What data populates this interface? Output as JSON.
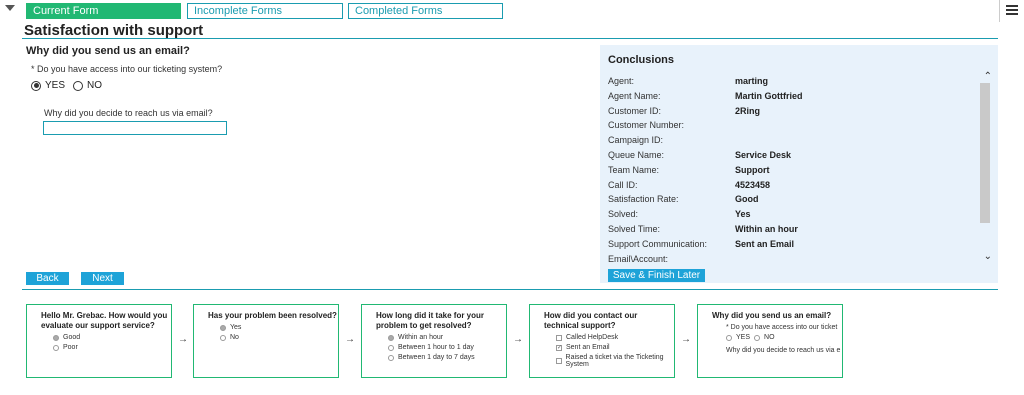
{
  "tabs": [
    {
      "label": "Current Form",
      "active": true
    },
    {
      "label": "Incomplete Forms",
      "active": false
    },
    {
      "label": "Completed Forms",
      "active": false
    }
  ],
  "page_title": "Satisfaction with support",
  "question_heading": "Why did you send us an email?",
  "q1": {
    "text": "* Do you have access into our ticketing system?",
    "options": [
      {
        "label": "YES",
        "selected": true
      },
      {
        "label": "NO",
        "selected": false
      }
    ]
  },
  "q2": {
    "text": "Why did you decide to reach us via email?",
    "value": ""
  },
  "buttons": {
    "back": "Back",
    "next": "Next",
    "save": "Save & Finish Later"
  },
  "conclusions": {
    "title": "Conclusions",
    "rows": [
      {
        "label": "Agent:",
        "value": "marting"
      },
      {
        "label": "Agent Name:",
        "value": "Martin Gottfried"
      },
      {
        "label": "Customer ID:",
        "value": "2Ring"
      },
      {
        "label": "Customer Number:",
        "value": ""
      },
      {
        "label": "Campaign ID:",
        "value": ""
      },
      {
        "label": "Queue Name:",
        "value": "Service Desk"
      },
      {
        "label": "Team Name:",
        "value": "Support"
      },
      {
        "label": "Call ID:",
        "value": "4523458"
      },
      {
        "label": "Satisfaction Rate:",
        "value": "Good"
      },
      {
        "label": "Solved:",
        "value": "Yes"
      },
      {
        "label": "Solved Time:",
        "value": "Within an hour"
      },
      {
        "label": "Support Communication:",
        "value": "Sent an Email"
      },
      {
        "label": "Email\\Account:",
        "value": ""
      }
    ]
  },
  "flow": [
    {
      "title": "Hello Mr. Grebac. How would you evaluate our support service?",
      "type": "radio",
      "options": [
        {
          "label": "Good",
          "on": true
        },
        {
          "label": "Poor",
          "on": false
        }
      ]
    },
    {
      "title": "Has your problem been resolved?",
      "type": "radio",
      "options": [
        {
          "label": "Yes",
          "on": true
        },
        {
          "label": "No",
          "on": false
        }
      ]
    },
    {
      "title": "How long did it take for your problem to get resolved?",
      "type": "radio",
      "options": [
        {
          "label": "Within an hour",
          "on": true
        },
        {
          "label": "Between 1 hour to 1 day",
          "on": false
        },
        {
          "label": "Between 1 day to 7 days",
          "on": false
        }
      ]
    },
    {
      "title": "How did you contact our technical support?",
      "type": "check",
      "options": [
        {
          "label": "Called HelpDesk",
          "on": false
        },
        {
          "label": "Sent an Email",
          "on": true
        },
        {
          "label": "Raised a ticket via the Ticketing System",
          "on": false
        }
      ]
    },
    {
      "title": "Why did you send us an email?",
      "type": "mixed",
      "line1": "* Do you have access into our ticket",
      "opt_yes": "YES",
      "opt_no": "NO",
      "line2": "Why did you decide to reach us via e"
    }
  ],
  "icons": {
    "tab_toggle": "caret-down-icon",
    "menu": "hamburger-icon",
    "flow_arrow": "arrow-right-icon"
  },
  "colors": {
    "accent": "#1a9cb0",
    "active_tab": "#21b873",
    "button": "#1ea3d8",
    "panel": "#e8f2fb"
  }
}
